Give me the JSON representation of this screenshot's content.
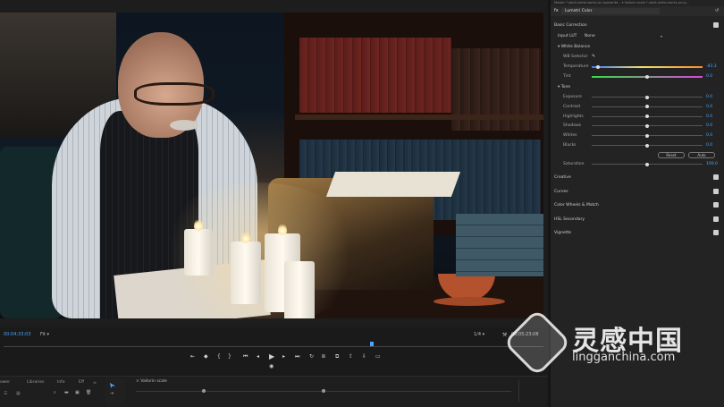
{
  "program_monitor": {
    "timecode_current": "00;04;33;03",
    "fit": "Fit",
    "quality": "1/4",
    "timecode_duration": "00;05;23;08"
  },
  "bottom_panels": {
    "tabs": [
      "ower",
      "Libraries",
      "Info",
      "Eff"
    ],
    "sequence_tab": "Vallorin scale",
    "sequence_close": "×"
  },
  "lumetri": {
    "header_tabs": "Master * adult-writer-works-on-typewrite...   ▾  Vallorin scale * adult-writer-works-on-ty...",
    "fx_label": "fx",
    "effect": "Lumetri Color",
    "basic_correction": "Basic Correction",
    "input_lut_label": "Input LUT",
    "input_lut_value": "None",
    "white_balance": "White Balance",
    "wb_selector": "WB Selector",
    "temperature": {
      "label": "Temperature",
      "value": "-83.3",
      "level": 0.05
    },
    "tint": {
      "label": "Tint",
      "value": "0.0",
      "level": 0.5
    },
    "tone": "Tone",
    "tone_params": [
      {
        "label": "Exposure",
        "value": "0.0",
        "level": 0.5
      },
      {
        "label": "Contrast",
        "value": "0.0",
        "level": 0.5
      },
      {
        "label": "Highlights",
        "value": "0.0",
        "level": 0.5
      },
      {
        "label": "Shadows",
        "value": "0.0",
        "level": 0.5
      },
      {
        "label": "Whites",
        "value": "0.0",
        "level": 0.5
      },
      {
        "label": "Blacks",
        "value": "0.0",
        "level": 0.5
      }
    ],
    "reset_button": "Reset",
    "auto_button": "Auto",
    "saturation": {
      "label": "Saturation",
      "value": "100.0",
      "level": 0.5
    },
    "sections": [
      "Creative",
      "Curves",
      "Color Wheels & Match",
      "HSL Secondary",
      "Vignette"
    ]
  },
  "watermark": {
    "cn": "灵感中国",
    "url": "lingganchina.com"
  },
  "colors": {
    "accent": "#4aa3ff",
    "panel_bg": "#232323",
    "temperature_gradient": [
      "#3d7bff",
      "#f0e070",
      "#ff8a2a"
    ],
    "tint_gradient": [
      "#33dd44",
      "#dd44dd"
    ]
  }
}
